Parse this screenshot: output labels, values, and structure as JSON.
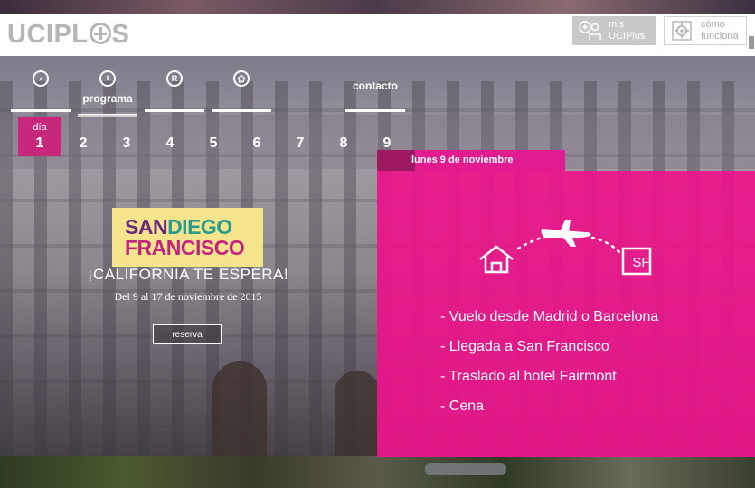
{
  "header": {
    "logo_left": "UCIPL",
    "logo_right": "S",
    "mis_line1": "mis",
    "mis_line2": "UCIPlus",
    "como_line1": "cómo",
    "como_line2": "funciona"
  },
  "nav": {
    "items": [
      {
        "icon": "compass-icon",
        "label": ""
      },
      {
        "icon": "clock-icon",
        "label": "programa"
      },
      {
        "icon": "r-badge-icon",
        "label": ""
      },
      {
        "icon": "hotel-icon",
        "label": ""
      },
      {
        "icon": "",
        "label": "contacto"
      }
    ]
  },
  "days": {
    "label": "día",
    "items": [
      "1",
      "2",
      "3",
      "4",
      "5",
      "6",
      "7",
      "8",
      "9"
    ],
    "active": "1"
  },
  "promo": {
    "san": "SAN",
    "diego": "DIEGO",
    "francisco": "FRANCISCO",
    "tagline": "¡CALIFORNIA TE ESPERA!",
    "dates": "Del 9 al 17 de noviembre de 2015",
    "reserva": "reserva"
  },
  "panel": {
    "tab_title": "lunes 9 de noviembre",
    "sf_label": "SF",
    "plan": [
      "- Vuelo desde Madrid o Barcelona",
      "- Llegada a San Francisco",
      "- Traslado al hotel Fairmont",
      "- Cena"
    ]
  },
  "colors": {
    "accent_pink": "#e21c8e",
    "active_day": "#c8287c",
    "promo_bg": "#f5e48c"
  }
}
